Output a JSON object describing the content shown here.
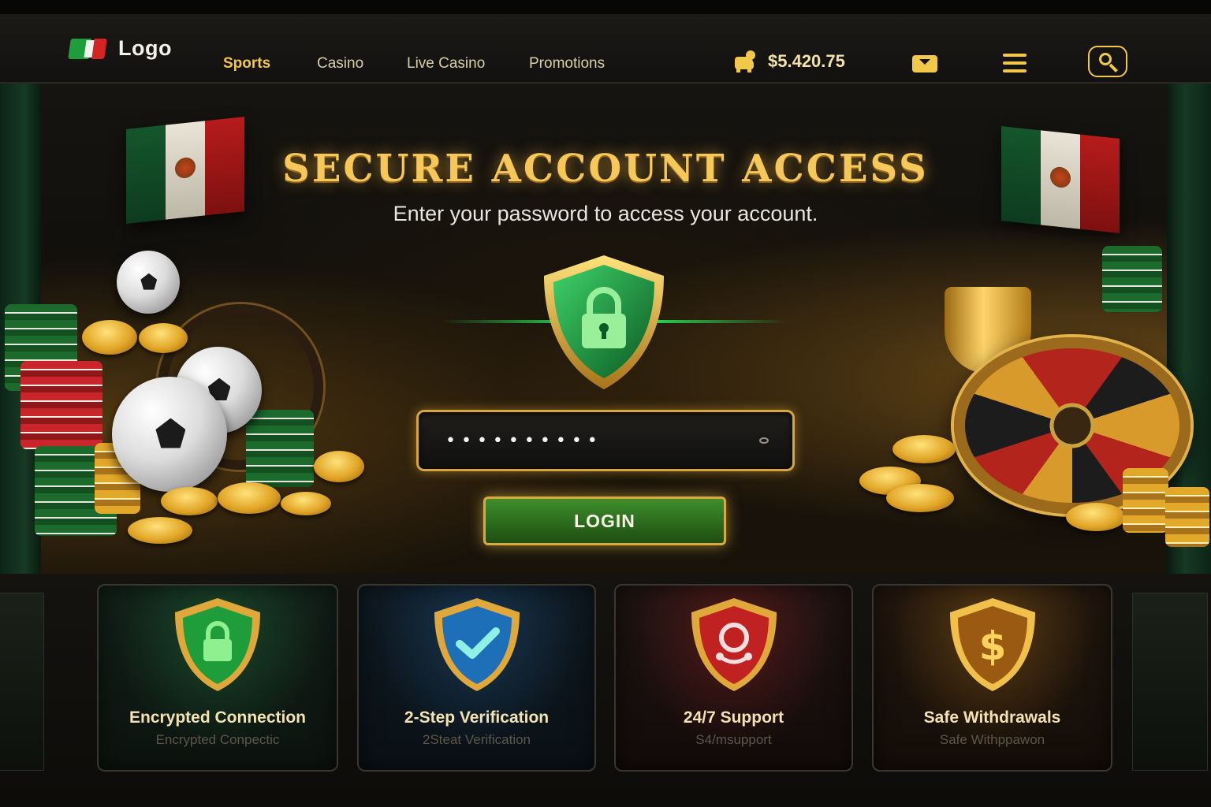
{
  "nav": {
    "logo_text": "Logo",
    "links": [
      "Sports",
      "Casino",
      "Live Casino",
      "Promotions"
    ],
    "active_link": "Sports",
    "balance": "$5.420.75"
  },
  "hero": {
    "title": "SECURE ACCOUNT ACCESS",
    "subtitle": "Enter your password to access your account.",
    "password_masked": "••••••••••",
    "login_label": "LOGIN"
  },
  "features": [
    {
      "title": "Encrypted Connection",
      "subtitle": "Encrypted Conpectic",
      "icon": "lock-shield-icon",
      "color": "#1f9d3a"
    },
    {
      "title": "2-Step Verification",
      "subtitle": "2Steat Verification",
      "icon": "check-shield-icon",
      "color": "#1d6fb8"
    },
    {
      "title": "24/7 Support",
      "subtitle": "S4/msupport",
      "icon": "support-shield-icon",
      "color": "#c02222"
    },
    {
      "title": "Safe Withdrawals",
      "subtitle": "Safe Withppawon",
      "icon": "dollar-shield-icon",
      "color": "#c8871f"
    }
  ],
  "colors": {
    "accent_gold": "#f2c84b",
    "login_green": "#2b6b1c",
    "background": "#0b0a08"
  }
}
